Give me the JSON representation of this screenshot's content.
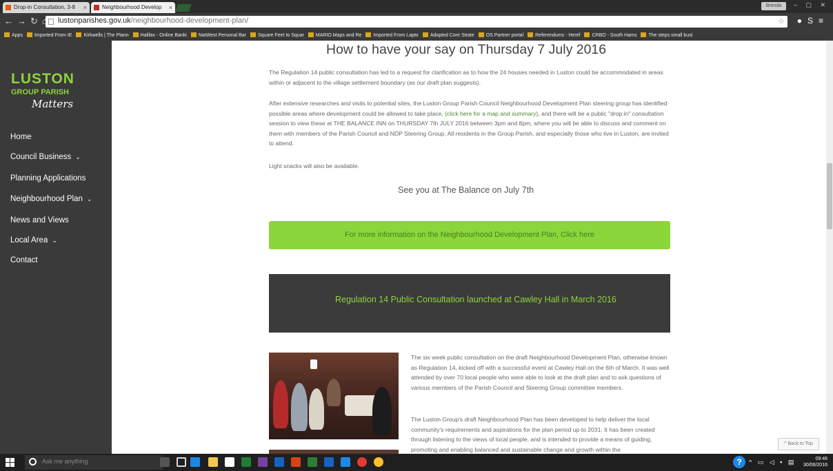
{
  "browser": {
    "tabs": [
      {
        "label": "Drop-in Consultation, 3-8"
      },
      {
        "label": "Neighbourhood Develop"
      }
    ],
    "user_label": "Brenda",
    "window_controls": "– ▢ ✕",
    "url_host": "lustonparishes.gov.uk",
    "url_path": "/neighbourhood-development-plan/",
    "bookmarks": [
      "Apps",
      "Imported From IE",
      "Kirkwells | The Plann",
      "Halifax - Online Banki",
      "NatWest Personal Bar",
      "Square Feet to Squar",
      "MARIO Maps and Re",
      "Imported From Lapto",
      "Adopted Core Strate",
      "OS Partner portal",
      "Referendums - Heref",
      "CRBO - South Hams",
      "The steps small busi"
    ]
  },
  "sidebar": {
    "logo_line1": "LUSTON",
    "logo_line2": "GROUP PARISH",
    "logo_line3": "Matters",
    "items": [
      {
        "label": "Home",
        "chevron": ""
      },
      {
        "label": "Council Business",
        "chevron": "⌄"
      },
      {
        "label": "Planning Applications",
        "chevron": ""
      },
      {
        "label": "Neighbourhood Plan",
        "chevron": "⌄"
      },
      {
        "label": "News and Views",
        "chevron": ""
      },
      {
        "label": "Local Area",
        "chevron": "⌄"
      },
      {
        "label": "Contact",
        "chevron": ""
      }
    ]
  },
  "main": {
    "heading": "How to have your say on Thursday 7 July 2016",
    "p1": "The Regulation 14 public consultation has led to a request for clarification as to how the 24 houses needed in Luston could be accommodated in areas within or adjacent to the village settlement boundary (as our draft plan suggests).",
    "p2a": "After extensive researches and visits to potential sites, the Luston Group Parish Council Neighbourhood Development Plan steering group has identified possible areas where development could be allowed to take place,",
    "p2_link": "(click here for a map and summary)",
    "p2b": ", and there will be a public \"drop in\" consultation session to view these at THE BALANCE INN on THURSDAY 7th JULY 2016 between 3pm and 8pm, where you will be able to discuss and comment on them with members of the Parish Council and NDP Steering Group. All residents in the Group Parish, and especially those who live in Luston, are invited to attend.",
    "p3": "Light snacks will also be available.",
    "see_you": "See you at The Balance on July 7th",
    "cta": "For more information on the Neighbourhood Development Plan, Click here",
    "band_title": "Regulation 14 Public Consultation launched at Cawley Hall in March 2016",
    "body1": "The six week public consultation on the draft Neighbourhood Development Plan, otherwise known as Regulation 14, kicked off with a successful event at Cawley Hall on the 6th of March. It was well attended by over 70 local people who were able to look at the draft plan and to ask questions of various members of the Parish Council and Steering Group committee members.",
    "body2": "The Luston Group's draft Neighbourhood Plan has been developed to help deliver the local community's requirements and aspirations for the plan period up to 2031. It has been created through listening to the views of local people, and is intended to provide a means of guiding, promoting and enabling balanced and sustainable change and growth within the",
    "back_to_top": "^ Back to Top"
  },
  "taskbar": {
    "search_placeholder": "Ask me anything",
    "time": "09:46",
    "date": "30/06/2016"
  }
}
